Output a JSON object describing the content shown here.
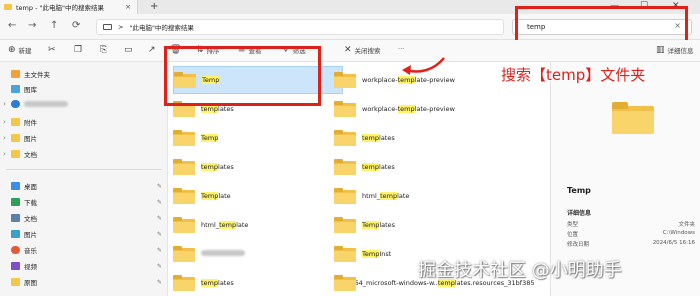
{
  "tab": {
    "title": "temp - \"此电脑\"中的搜索结果",
    "close": "×",
    "new_tab": "+"
  },
  "window_controls": {
    "minimize": "—",
    "maximize": "☐",
    "close": "✕"
  },
  "nav": {
    "back": "←",
    "forward": "→",
    "up": "↑",
    "refresh": "⟳"
  },
  "address": {
    "separator": ">",
    "path": "\"此电脑\"中的搜索结果"
  },
  "search": {
    "value": "temp",
    "clear": "×"
  },
  "toolbar": {
    "new_label": "新建",
    "sort_label": "排序",
    "view_label": "查看",
    "filter_label": "筛选",
    "close_search_label": "关闭搜索",
    "more_label": "···",
    "details_label": "详细信息"
  },
  "sidebar": {
    "home": "主文件夹",
    "gallery": "图库",
    "attachments": "附件",
    "pictures_top": "图片",
    "documents_top": "文档",
    "desktop": "桌面",
    "downloads": "下载",
    "documents": "文档",
    "pictures": "图片",
    "music": "音乐",
    "videos": "视频",
    "recycle": "原图"
  },
  "files_left": [
    {
      "pre": "",
      "hl": "Temp",
      "post": ""
    },
    {
      "pre": "",
      "hl": "temp",
      "post": "lates"
    },
    {
      "pre": "",
      "hl": "Temp",
      "post": ""
    },
    {
      "pre": "",
      "hl": "temp",
      "post": "lates"
    },
    {
      "pre": "",
      "hl": "Temp",
      "post": "late"
    },
    {
      "pre": "html_",
      "hl": "temp",
      "post": "late"
    },
    {
      "pre": "",
      "hl": "",
      "post": ""
    },
    {
      "pre": "",
      "hl": "temp",
      "post": "lates"
    }
  ],
  "files_right": [
    {
      "pre": "workplace-",
      "hl": "temp",
      "post": "late-preview"
    },
    {
      "pre": "workplace-",
      "hl": "temp",
      "post": "late-preview"
    },
    {
      "pre": "",
      "hl": "temp",
      "post": "lates"
    },
    {
      "pre": "",
      "hl": "temp",
      "post": "lates"
    },
    {
      "pre": "html_",
      "hl": "temp",
      "post": "late"
    },
    {
      "pre": "",
      "hl": "Temp",
      "post": "lates"
    },
    {
      "pre": "",
      "hl": "Temp",
      "post": "Inst"
    },
    {
      "pre": "amd64_microsoft-windows-w..",
      "hl": "temp",
      "post": "lates.resources_31bf385"
    }
  ],
  "details": {
    "title": "Temp",
    "section": "详细信息",
    "rows": [
      {
        "label": "类型",
        "value": "文件夹"
      },
      {
        "label": "位置",
        "value": "C:\\Windows"
      },
      {
        "label": "修改日期",
        "value": "2024/6/5 16:16"
      }
    ]
  },
  "annotation": "搜索【temp】文件夹",
  "watermark": "掘金技术社区 @小明助手",
  "colors": {
    "highlight": "#fff36b",
    "selection": "#cde5fb",
    "red": "#e0211a",
    "folder": "#f8d46a"
  }
}
